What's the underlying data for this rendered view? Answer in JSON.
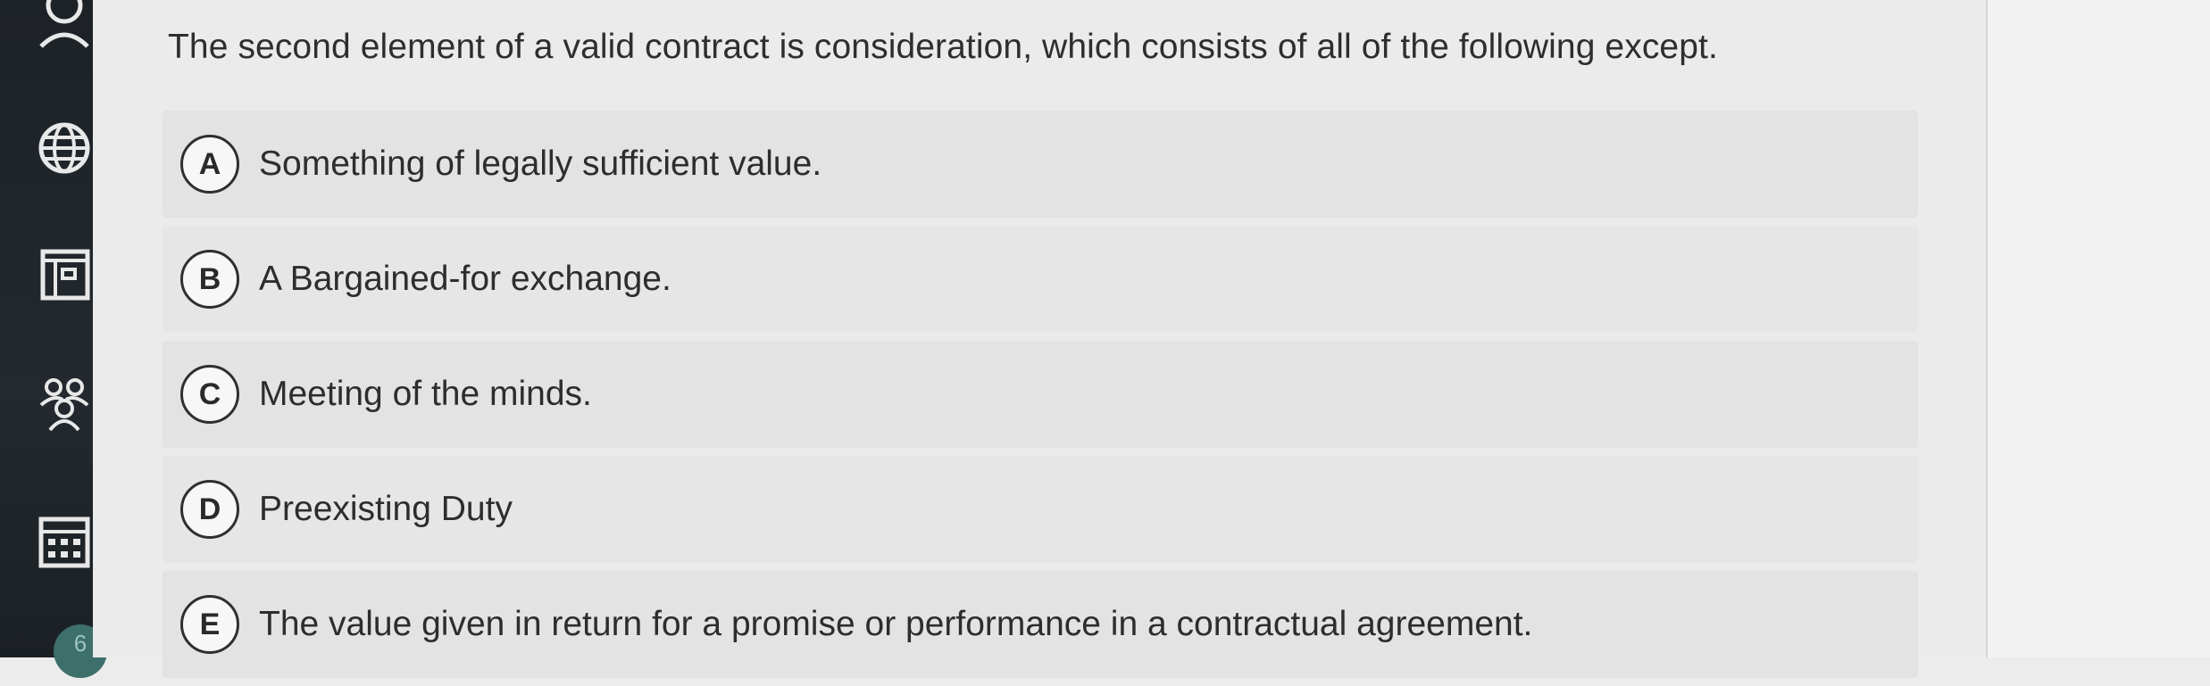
{
  "sidebar": {
    "icons": [
      {
        "name": "profile-icon"
      },
      {
        "name": "globe-icon"
      },
      {
        "name": "book-icon"
      },
      {
        "name": "community-icon"
      },
      {
        "name": "calendar-icon"
      }
    ],
    "badge_text": "6"
  },
  "question": {
    "text": "The second element of a valid contract is consideration, which consists of all of the following except."
  },
  "options": [
    {
      "letter": "A",
      "text": "Something of legally sufficient value."
    },
    {
      "letter": "B",
      "text": "A Bargained-for exchange."
    },
    {
      "letter": "C",
      "text": "Meeting of the minds."
    },
    {
      "letter": "D",
      "text": "Preexisting Duty"
    },
    {
      "letter": "E",
      "text": "The value given in return for a promise or performance in a contractual agreement."
    }
  ],
  "colors": {
    "rail": "#1d2227",
    "background": "#ebebeb",
    "option_background": "#e3e3e3",
    "text": "#2d2d2d"
  }
}
